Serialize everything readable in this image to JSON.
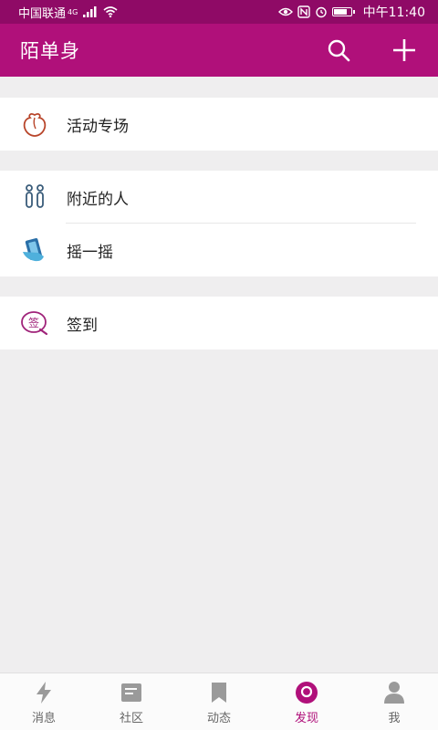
{
  "status_bar": {
    "carrier": "中国联通",
    "network": "4G",
    "time": "中午11:40"
  },
  "header": {
    "title": "陌单身",
    "actions": [
      {
        "name": "search-icon"
      },
      {
        "name": "add-icon"
      }
    ]
  },
  "menu": {
    "groups": [
      {
        "items": [
          {
            "label": "活动专场",
            "icon": "event-peach-icon"
          }
        ]
      },
      {
        "items": [
          {
            "label": "附近的人",
            "icon": "people-nearby-icon"
          },
          {
            "label": "摇一摇",
            "icon": "shake-phone-icon"
          }
        ]
      },
      {
        "items": [
          {
            "label": "签到",
            "icon": "sign-in-icon",
            "badge_text": "签"
          }
        ]
      }
    ]
  },
  "bottom_nav": {
    "tabs": [
      {
        "label": "消息",
        "icon": "lightning-icon"
      },
      {
        "label": "社区",
        "icon": "community-icon"
      },
      {
        "label": "动态",
        "icon": "bookmark-icon"
      },
      {
        "label": "发现",
        "icon": "discover-icon",
        "active": true
      },
      {
        "label": "我",
        "icon": "profile-icon"
      }
    ]
  },
  "colors": {
    "status_bar": "#8f0a66",
    "header": "#b0107a",
    "accent": "#b0107a",
    "page_bg": "#efeeef"
  }
}
